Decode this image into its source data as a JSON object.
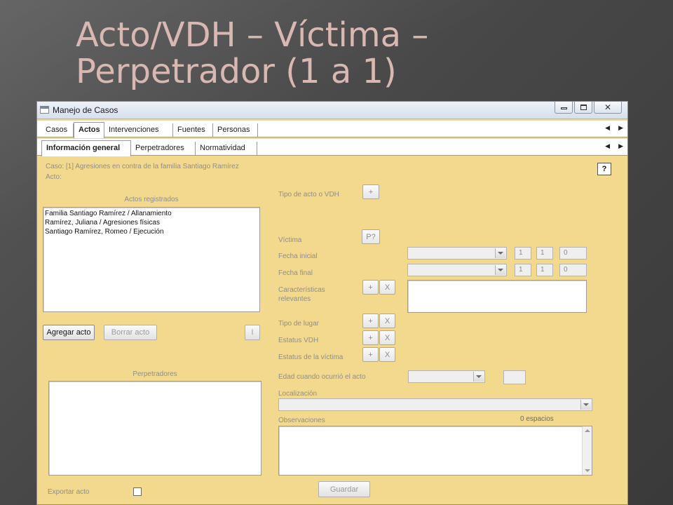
{
  "slide": {
    "title": "Acto/VDH – Víctima – Perpetrador (1 a 1)"
  },
  "window": {
    "title": "Manejo de Casos",
    "controls": {
      "minimize": "",
      "maximize": "",
      "close": "✕"
    }
  },
  "main_tabs": [
    {
      "label": "Casos",
      "active": false
    },
    {
      "label": "Actos",
      "active": true
    },
    {
      "label": "Intervenciones",
      "active": false
    },
    {
      "label": "Fuentes",
      "active": false
    },
    {
      "label": "Personas",
      "active": false
    }
  ],
  "sub_tabs": [
    {
      "label": "Información general",
      "active": true
    },
    {
      "label": "Perpetradores",
      "active": false
    },
    {
      "label": "Normatividad",
      "active": false
    }
  ],
  "tab_arrows": {
    "left": "◀",
    "right": "▶"
  },
  "left_panel": {
    "caso_label": "Caso: [1] Agresiones en contra de la familia Santiago Ramírez",
    "acto_label": "Acto:",
    "actos_registrados_title": "Actos registrados",
    "actos": [
      "Familia Santiago Ramírez / Allanamiento",
      "Ramírez, Juliana / Agresiones físicas",
      "Santiago Ramírez, Romeo / Ejecución"
    ],
    "agregar_button": "Agregar acto",
    "borrar_button": "Borrar acto",
    "i_button": "I",
    "perpetradores_title": "Perpetradores",
    "exportar_label": "Exportar acto",
    "exportar_checked": false
  },
  "right_panel": {
    "help_button": "?",
    "tipo_acto_label": "Tipo de acto o VDH",
    "tipo_acto_add": "+",
    "victima_label": "Víctima",
    "victima_button": "P?",
    "fecha_inicial_label": "Fecha inicial",
    "fecha_inicial": {
      "selected": "",
      "day": "1",
      "month": "1",
      "year": "0"
    },
    "fecha_final_label": "Fecha final",
    "fecha_final": {
      "selected": "",
      "day": "1",
      "month": "1",
      "year": "0"
    },
    "caracteristicas_label_1": "Características",
    "caracteristicas_label_2": "relevantes",
    "tipo_lugar_label": "Tipo de lugar",
    "estatus_vdh_label": "Estatus VDH",
    "estatus_victima_label": "Estatus de la víctima",
    "add_symbol": "+",
    "remove_symbol": "X",
    "edad_label": "Edad cuando ocurrió el acto",
    "edad_selected": "",
    "edad_value": "",
    "localizacion_label": "Localización",
    "localizacion_selected": "",
    "observaciones_label": "Observaciones",
    "espacios_label": "0 espacios",
    "guardar_button": "Guardar"
  },
  "colors": {
    "panel_background": "#f3d98e",
    "slide_title": "#d9b8b2",
    "label_text": "#8e8e8e"
  }
}
